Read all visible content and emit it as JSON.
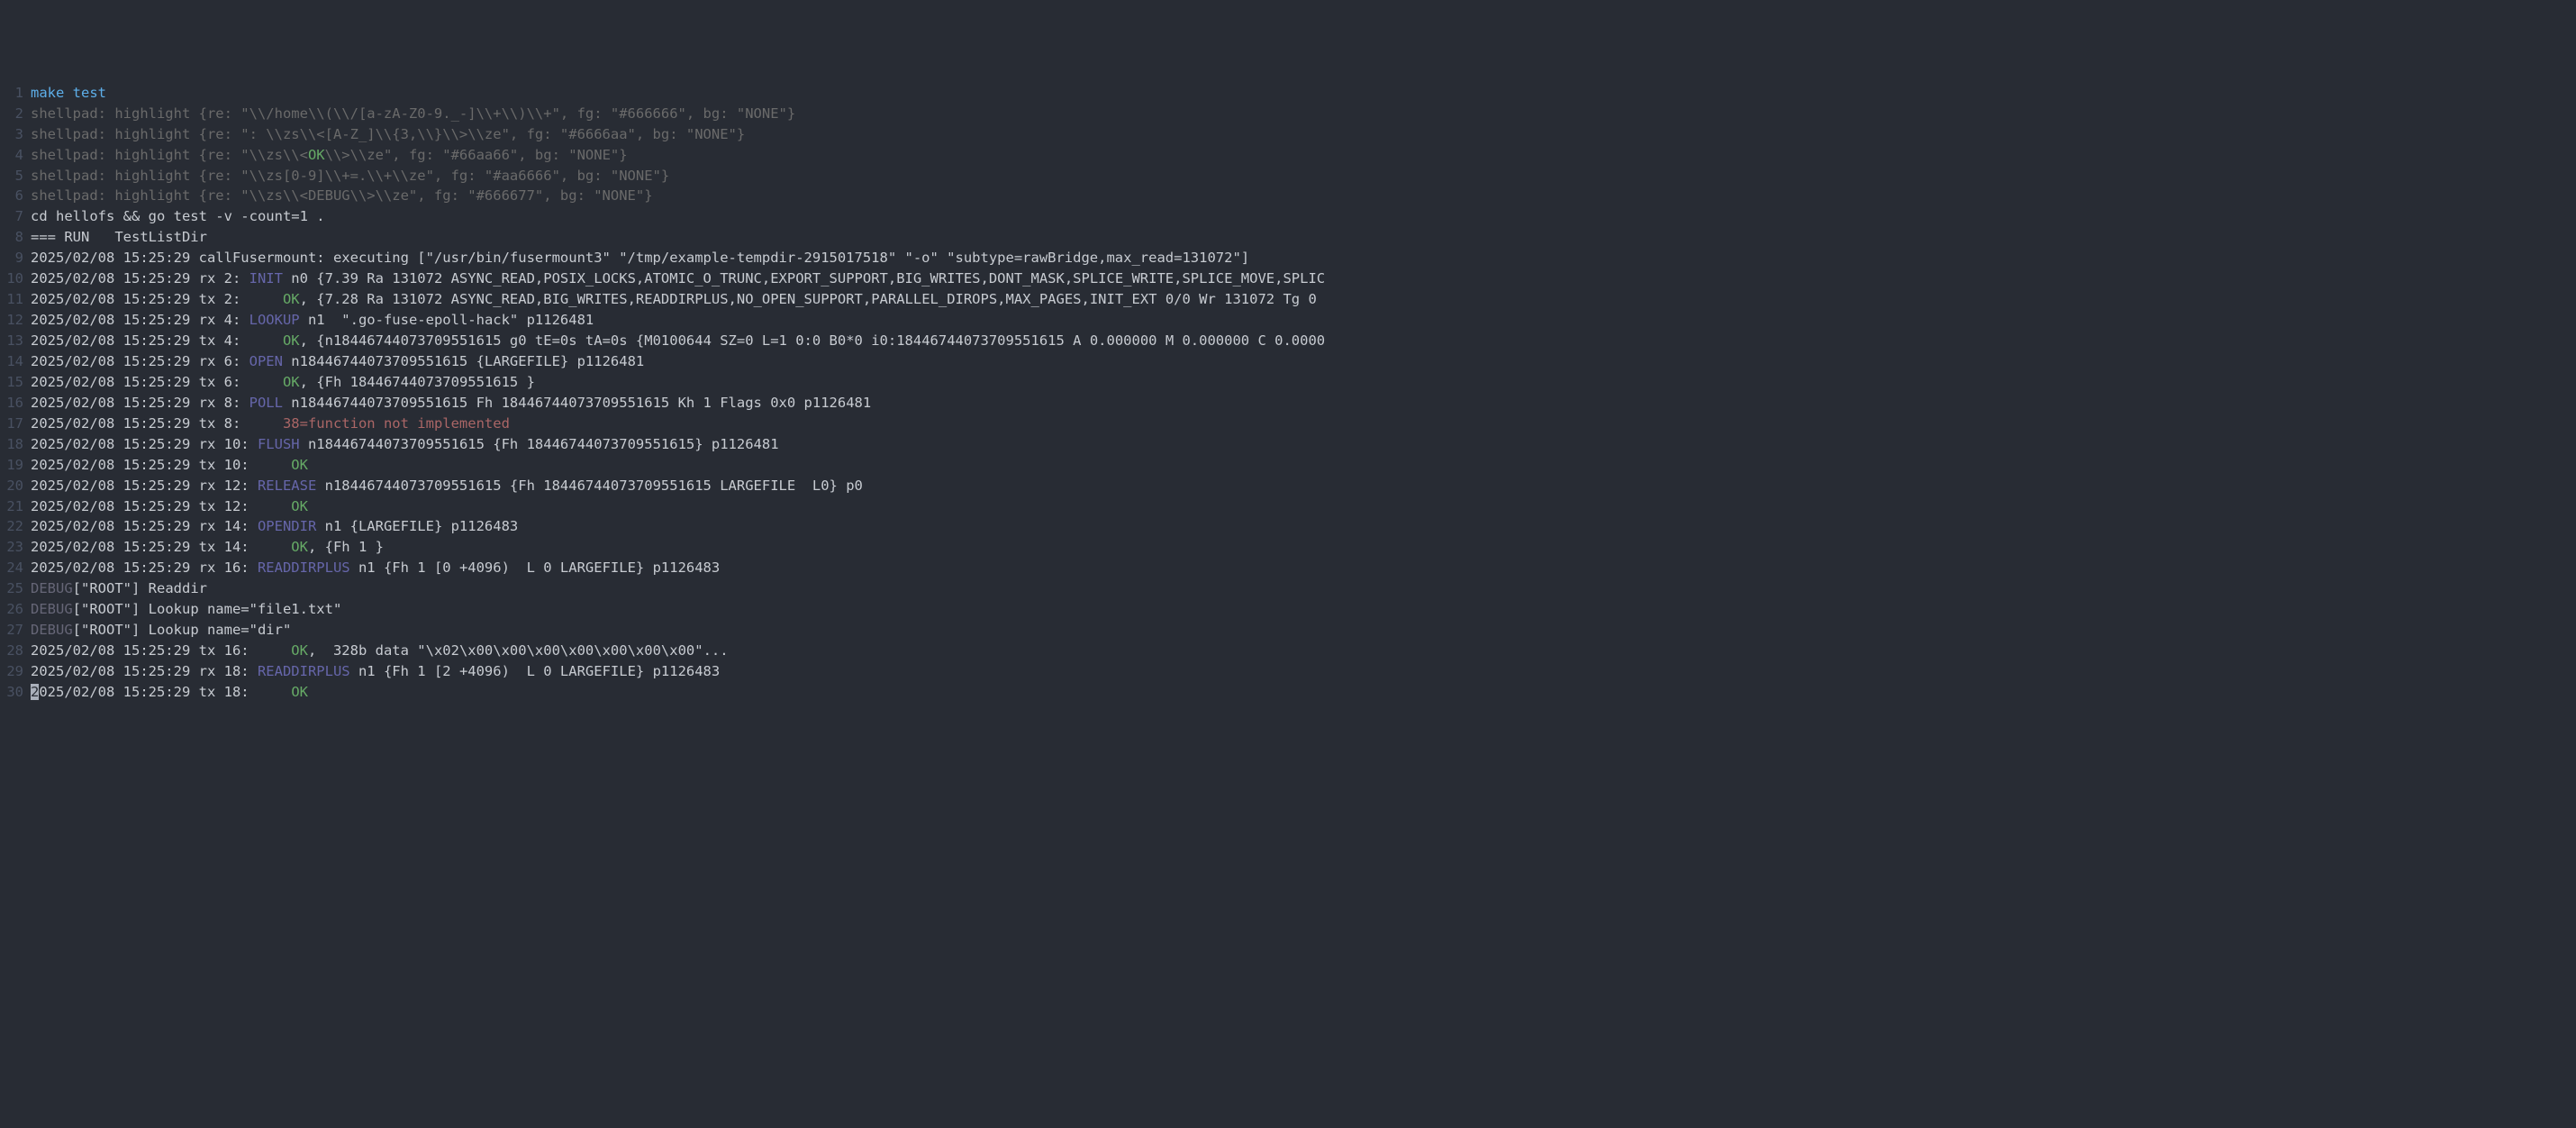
{
  "colors": {
    "bg": "#282c34",
    "fg": "#abb2bf",
    "gutter": "#495162",
    "cmd": "#5daee8",
    "grey": "#6a6a6a",
    "op": "#6666aa",
    "ok": "#66aa66",
    "err": "#aa6666",
    "debug": "#666677",
    "plain": "#c7cbd1"
  },
  "cursor": {
    "line": 30,
    "col": 0
  },
  "lines": [
    {
      "n": 1,
      "tokens": [
        {
          "cls": "tk-cmd",
          "t": "make test"
        }
      ]
    },
    {
      "n": 2,
      "tokens": [
        {
          "cls": "tk-grey",
          "t": "shellpad: highlight {re: \"\\\\/home\\\\(\\\\/[a-zA-Z0-9._-]\\\\+\\\\)\\\\+\", fg: \"#666666\", bg: \"NONE\"}"
        }
      ]
    },
    {
      "n": 3,
      "tokens": [
        {
          "cls": "tk-grey",
          "t": "shellpad: highlight {re: \": \\\\zs\\\\<[A-Z_]\\\\{3,\\\\}\\\\>\\\\ze\", fg: \"#6666aa\", bg: \"NONE\"}"
        }
      ]
    },
    {
      "n": 4,
      "tokens": [
        {
          "cls": "tk-grey",
          "t": "shellpad: highlight {re: \"\\\\zs\\\\<"
        },
        {
          "cls": "tk-ok",
          "t": "OK"
        },
        {
          "cls": "tk-grey",
          "t": "\\\\>\\\\ze\", fg: \"#66aa66\", bg: \"NONE\"}"
        }
      ]
    },
    {
      "n": 5,
      "tokens": [
        {
          "cls": "tk-grey",
          "t": "shellpad: highlight {re: \"\\\\zs[0-9]\\\\+=.\\\\+\\\\ze\", fg: \"#aa6666\", bg: \"NONE\"}"
        }
      ]
    },
    {
      "n": 6,
      "tokens": [
        {
          "cls": "tk-grey",
          "t": "shellpad: highlight {re: \"\\\\zs\\\\<DEBUG\\\\>\\\\ze\", fg: \"#666677\", bg: \"NONE\"}"
        }
      ]
    },
    {
      "n": 7,
      "tokens": [
        {
          "cls": "tk-plain",
          "t": "cd hellofs && go test -v -count=1 ."
        }
      ]
    },
    {
      "n": 8,
      "tokens": [
        {
          "cls": "tk-plain",
          "t": "=== RUN   TestListDir"
        }
      ]
    },
    {
      "n": 9,
      "tokens": [
        {
          "cls": "tk-plain",
          "t": "2025/02/08 15:25:29 callFusermount: executing [\"/usr/bin/fusermount3\" \"/tmp/example-tempdir-2915017518\" \"-o\" \"subtype=rawBridge,max_read=131072\"]"
        }
      ]
    },
    {
      "n": 10,
      "tokens": [
        {
          "cls": "tk-plain",
          "t": "2025/02/08 15:25:29 rx 2: "
        },
        {
          "cls": "tk-op",
          "t": "INIT"
        },
        {
          "cls": "tk-plain",
          "t": " n0 {7.39 Ra 131072 ASYNC_READ,POSIX_LOCKS,ATOMIC_O_TRUNC,EXPORT_SUPPORT,BIG_WRITES,DONT_MASK,SPLICE_WRITE,SPLICE_MOVE,SPLIC"
        }
      ]
    },
    {
      "n": 11,
      "tokens": [
        {
          "cls": "tk-plain",
          "t": "2025/02/08 15:25:29 tx 2:     "
        },
        {
          "cls": "tk-ok",
          "t": "OK"
        },
        {
          "cls": "tk-plain",
          "t": ", {7.28 Ra 131072 ASYNC_READ,BIG_WRITES,READDIRPLUS,NO_OPEN_SUPPORT,PARALLEL_DIROPS,MAX_PAGES,INIT_EXT 0/0 Wr 131072 Tg 0"
        }
      ]
    },
    {
      "n": 12,
      "tokens": [
        {
          "cls": "tk-plain",
          "t": "2025/02/08 15:25:29 rx 4: "
        },
        {
          "cls": "tk-op",
          "t": "LOOKUP"
        },
        {
          "cls": "tk-plain",
          "t": " n1  \".go-fuse-epoll-hack\" p1126481"
        }
      ]
    },
    {
      "n": 13,
      "tokens": [
        {
          "cls": "tk-plain",
          "t": "2025/02/08 15:25:29 tx 4:     "
        },
        {
          "cls": "tk-ok",
          "t": "OK"
        },
        {
          "cls": "tk-plain",
          "t": ", {n18446744073709551615 g0 tE=0s tA=0s {M0100644 SZ=0 L=1 0:0 B0*0 i0:18446744073709551615 A 0.000000 M 0.000000 C 0.0000"
        }
      ]
    },
    {
      "n": 14,
      "tokens": [
        {
          "cls": "tk-plain",
          "t": "2025/02/08 15:25:29 rx 6: "
        },
        {
          "cls": "tk-op",
          "t": "OPEN"
        },
        {
          "cls": "tk-plain",
          "t": " n18446744073709551615 {LARGEFILE} p1126481"
        }
      ]
    },
    {
      "n": 15,
      "tokens": [
        {
          "cls": "tk-plain",
          "t": "2025/02/08 15:25:29 tx 6:     "
        },
        {
          "cls": "tk-ok",
          "t": "OK"
        },
        {
          "cls": "tk-plain",
          "t": ", {Fh 18446744073709551615 }"
        }
      ]
    },
    {
      "n": 16,
      "tokens": [
        {
          "cls": "tk-plain",
          "t": "2025/02/08 15:25:29 rx 8: "
        },
        {
          "cls": "tk-op",
          "t": "POLL"
        },
        {
          "cls": "tk-plain",
          "t": " n18446744073709551615 Fh 18446744073709551615 Kh 1 Flags 0x0 p1126481"
        }
      ]
    },
    {
      "n": 17,
      "tokens": [
        {
          "cls": "tk-plain",
          "t": "2025/02/08 15:25:29 tx 8:     "
        },
        {
          "cls": "tk-err",
          "t": "38=function not implemented"
        }
      ]
    },
    {
      "n": 18,
      "tokens": [
        {
          "cls": "tk-plain",
          "t": "2025/02/08 15:25:29 rx 10: "
        },
        {
          "cls": "tk-op",
          "t": "FLUSH"
        },
        {
          "cls": "tk-plain",
          "t": " n18446744073709551615 {Fh 18446744073709551615} p1126481"
        }
      ]
    },
    {
      "n": 19,
      "tokens": [
        {
          "cls": "tk-plain",
          "t": "2025/02/08 15:25:29 tx 10:     "
        },
        {
          "cls": "tk-ok",
          "t": "OK"
        }
      ]
    },
    {
      "n": 20,
      "tokens": [
        {
          "cls": "tk-plain",
          "t": "2025/02/08 15:25:29 rx 12: "
        },
        {
          "cls": "tk-op",
          "t": "RELEASE"
        },
        {
          "cls": "tk-plain",
          "t": " n18446744073709551615 {Fh 18446744073709551615 LARGEFILE  L0} p0"
        }
      ]
    },
    {
      "n": 21,
      "tokens": [
        {
          "cls": "tk-plain",
          "t": "2025/02/08 15:25:29 tx 12:     "
        },
        {
          "cls": "tk-ok",
          "t": "OK"
        }
      ]
    },
    {
      "n": 22,
      "tokens": [
        {
          "cls": "tk-plain",
          "t": "2025/02/08 15:25:29 rx 14: "
        },
        {
          "cls": "tk-op",
          "t": "OPENDIR"
        },
        {
          "cls": "tk-plain",
          "t": " n1 {LARGEFILE} p1126483"
        }
      ]
    },
    {
      "n": 23,
      "tokens": [
        {
          "cls": "tk-plain",
          "t": "2025/02/08 15:25:29 tx 14:     "
        },
        {
          "cls": "tk-ok",
          "t": "OK"
        },
        {
          "cls": "tk-plain",
          "t": ", {Fh 1 }"
        }
      ]
    },
    {
      "n": 24,
      "tokens": [
        {
          "cls": "tk-plain",
          "t": "2025/02/08 15:25:29 rx 16: "
        },
        {
          "cls": "tk-op",
          "t": "READDIRPLUS"
        },
        {
          "cls": "tk-plain",
          "t": " n1 {Fh 1 [0 +4096)  L 0 LARGEFILE} p1126483"
        }
      ]
    },
    {
      "n": 25,
      "tokens": [
        {
          "cls": "tk-debug",
          "t": "DEBUG"
        },
        {
          "cls": "tk-plain",
          "t": "[\"ROOT\"] Readdir"
        }
      ]
    },
    {
      "n": 26,
      "tokens": [
        {
          "cls": "tk-debug",
          "t": "DEBUG"
        },
        {
          "cls": "tk-plain",
          "t": "[\"ROOT\"] Lookup name=\"file1.txt\""
        }
      ]
    },
    {
      "n": 27,
      "tokens": [
        {
          "cls": "tk-debug",
          "t": "DEBUG"
        },
        {
          "cls": "tk-plain",
          "t": "[\"ROOT\"] Lookup name=\"dir\""
        }
      ]
    },
    {
      "n": 28,
      "tokens": [
        {
          "cls": "tk-plain",
          "t": "2025/02/08 15:25:29 tx 16:     "
        },
        {
          "cls": "tk-ok",
          "t": "OK"
        },
        {
          "cls": "tk-plain",
          "t": ",  328b data \"\\x02\\x00\\x00\\x00\\x00\\x00\\x00\\x00\"..."
        }
      ]
    },
    {
      "n": 29,
      "tokens": [
        {
          "cls": "tk-plain",
          "t": "2025/02/08 15:25:29 rx 18: "
        },
        {
          "cls": "tk-op",
          "t": "READDIRPLUS"
        },
        {
          "cls": "tk-plain",
          "t": " n1 {Fh 1 [2 +4096)  L 0 LARGEFILE} p1126483"
        }
      ]
    },
    {
      "n": 30,
      "tokens": [
        {
          "cls": "tk-plain",
          "t": "2025/02/08 15:25:29 tx 18:     "
        },
        {
          "cls": "tk-ok",
          "t": "OK"
        }
      ]
    }
  ]
}
